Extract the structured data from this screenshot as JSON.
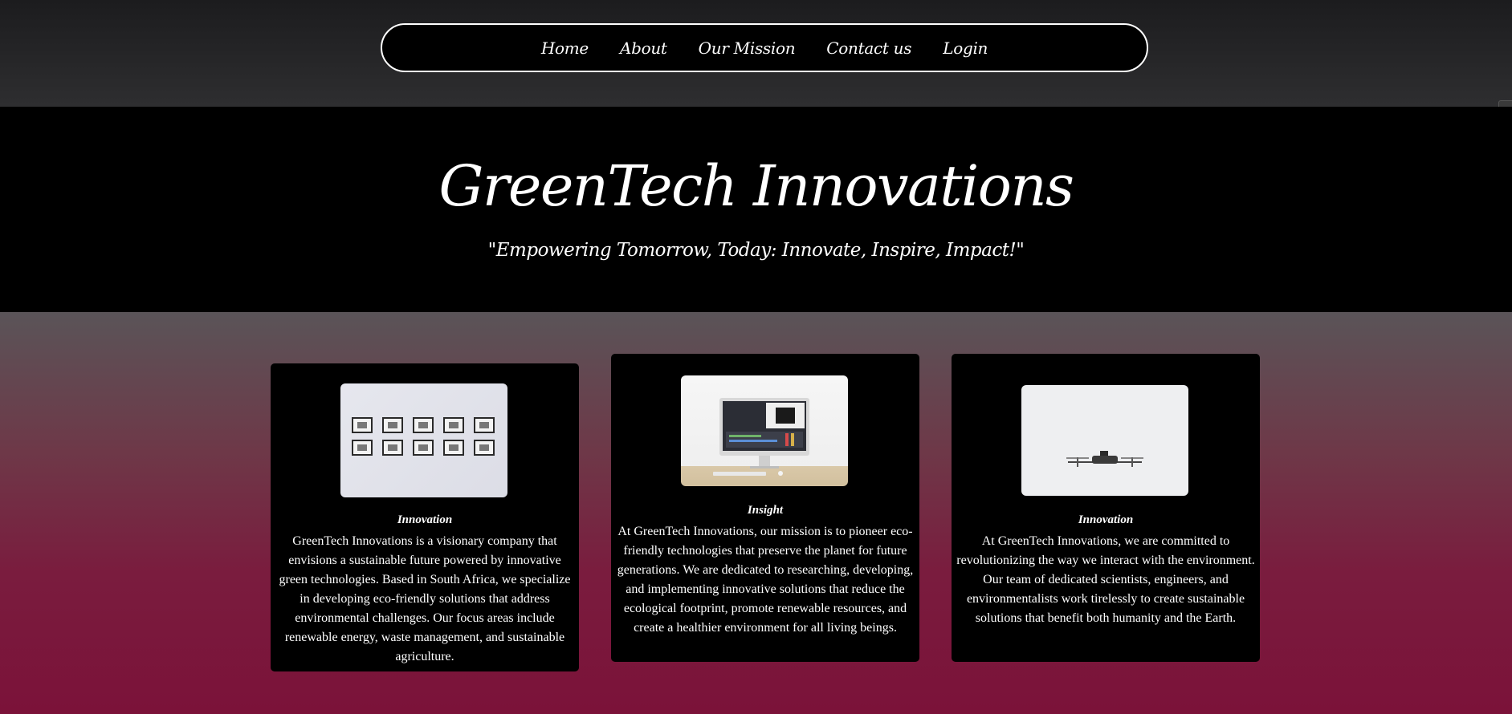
{
  "nav": {
    "items": [
      {
        "label": "Home"
      },
      {
        "label": "About"
      },
      {
        "label": "Our Mission"
      },
      {
        "label": "Contact us"
      },
      {
        "label": "Login"
      }
    ]
  },
  "hero": {
    "title": "GreenTech Innovations",
    "tagline": "\"Empowering Tomorrow, Today: Innovate, Inspire, Impact!\""
  },
  "cards": [
    {
      "title": "Innovation",
      "text": "GreenTech Innovations is a visionary company that envisions a sustainable future powered by innovative green technologies. Based in South Africa, we specialize in developing eco-friendly solutions that address environmental challenges. Our focus areas include renewable energy, waste management, and sustainable agriculture.",
      "image_icon": "framed-pictures-wall-image"
    },
    {
      "title": "Insight",
      "text": "At GreenTech Innovations, our mission is to pioneer eco-friendly technologies that preserve the planet for future generations. We are dedicated to researching, developing, and implementing innovative solutions that reduce the ecological footprint, promote renewable resources, and create a healthier environment for all living beings.",
      "image_icon": "computer-monitor-image"
    },
    {
      "title": "Innovation",
      "text": "At GreenTech Innovations, we are committed to revolutionizing the way we interact with the environment. Our team of dedicated scientists, engineers, and environmentalists work tirelessly to create sustainable solutions that benefit both humanity and the Earth.",
      "image_icon": "drone-image"
    }
  ],
  "colors": {
    "background_top": "#2e2e30",
    "hero": "#000000",
    "gradient_bottom": "#7b1239"
  }
}
